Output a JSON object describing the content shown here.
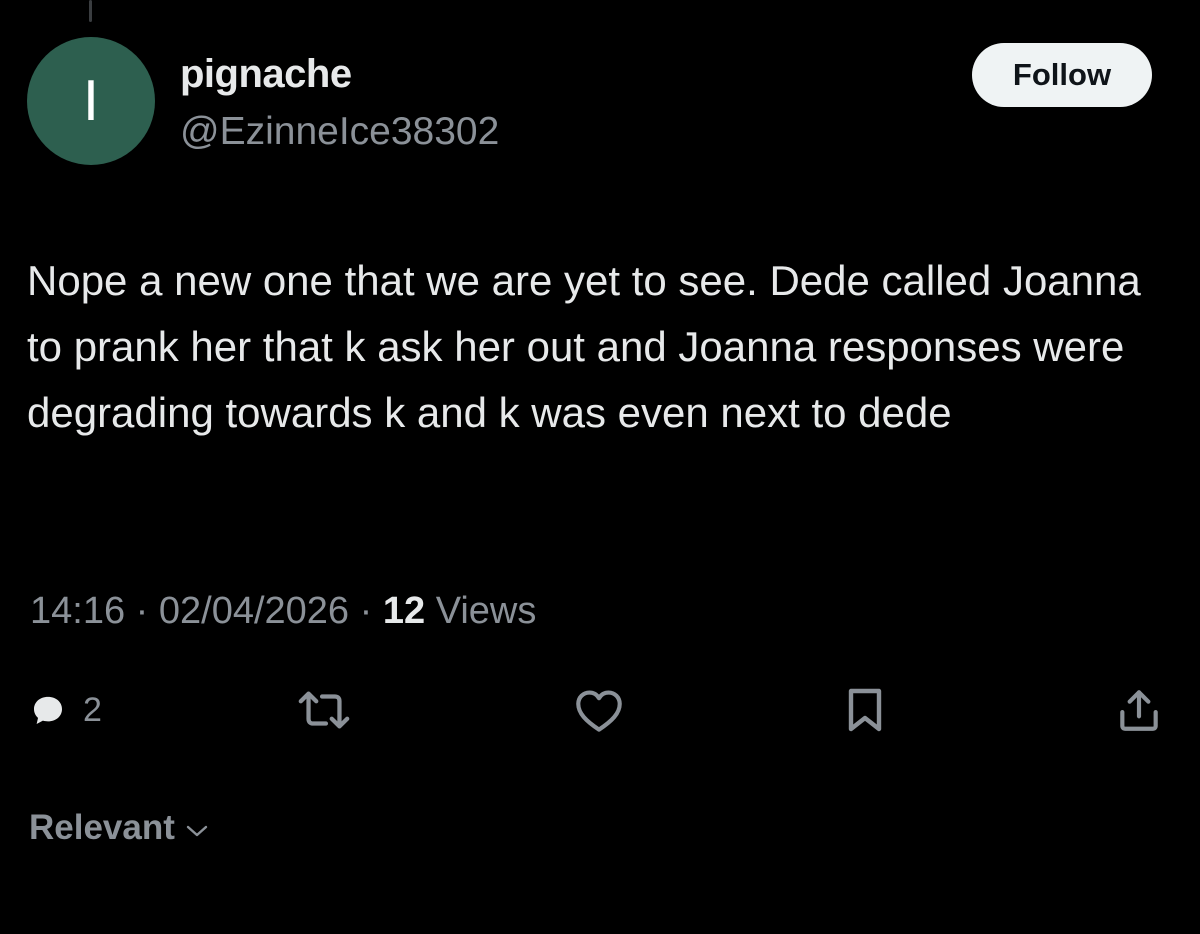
{
  "user": {
    "avatar_letter": "I",
    "avatar_color": "#2d5f4f",
    "display_name": "pignache",
    "handle": "@EzinneIce38302"
  },
  "follow_button": {
    "label": "Follow"
  },
  "tweet": {
    "text": "Nope a new one that we are yet to see. Dede called Joanna to prank her that k ask her out and Joanna responses were degrading towards k and k was even next to dede"
  },
  "meta": {
    "time": "14:16",
    "separator": "·",
    "date": "02/04/2026",
    "views_count": "12",
    "views_label": "Views"
  },
  "actions": {
    "reply_icon": "speech-bubble-icon",
    "reply_count": "2",
    "retweet_icon": "retweet-arrows-icon",
    "like_icon": "heart-icon",
    "bookmark_icon": "bookmark-icon",
    "share_icon": "share-upload-icon"
  },
  "sort": {
    "label": "Relevant",
    "icon": "chevron-down-icon"
  },
  "colors": {
    "background": "#000000",
    "primary_text": "#e7e9ea",
    "secondary_text": "#8b9198",
    "follow_bg": "#eff3f4"
  }
}
